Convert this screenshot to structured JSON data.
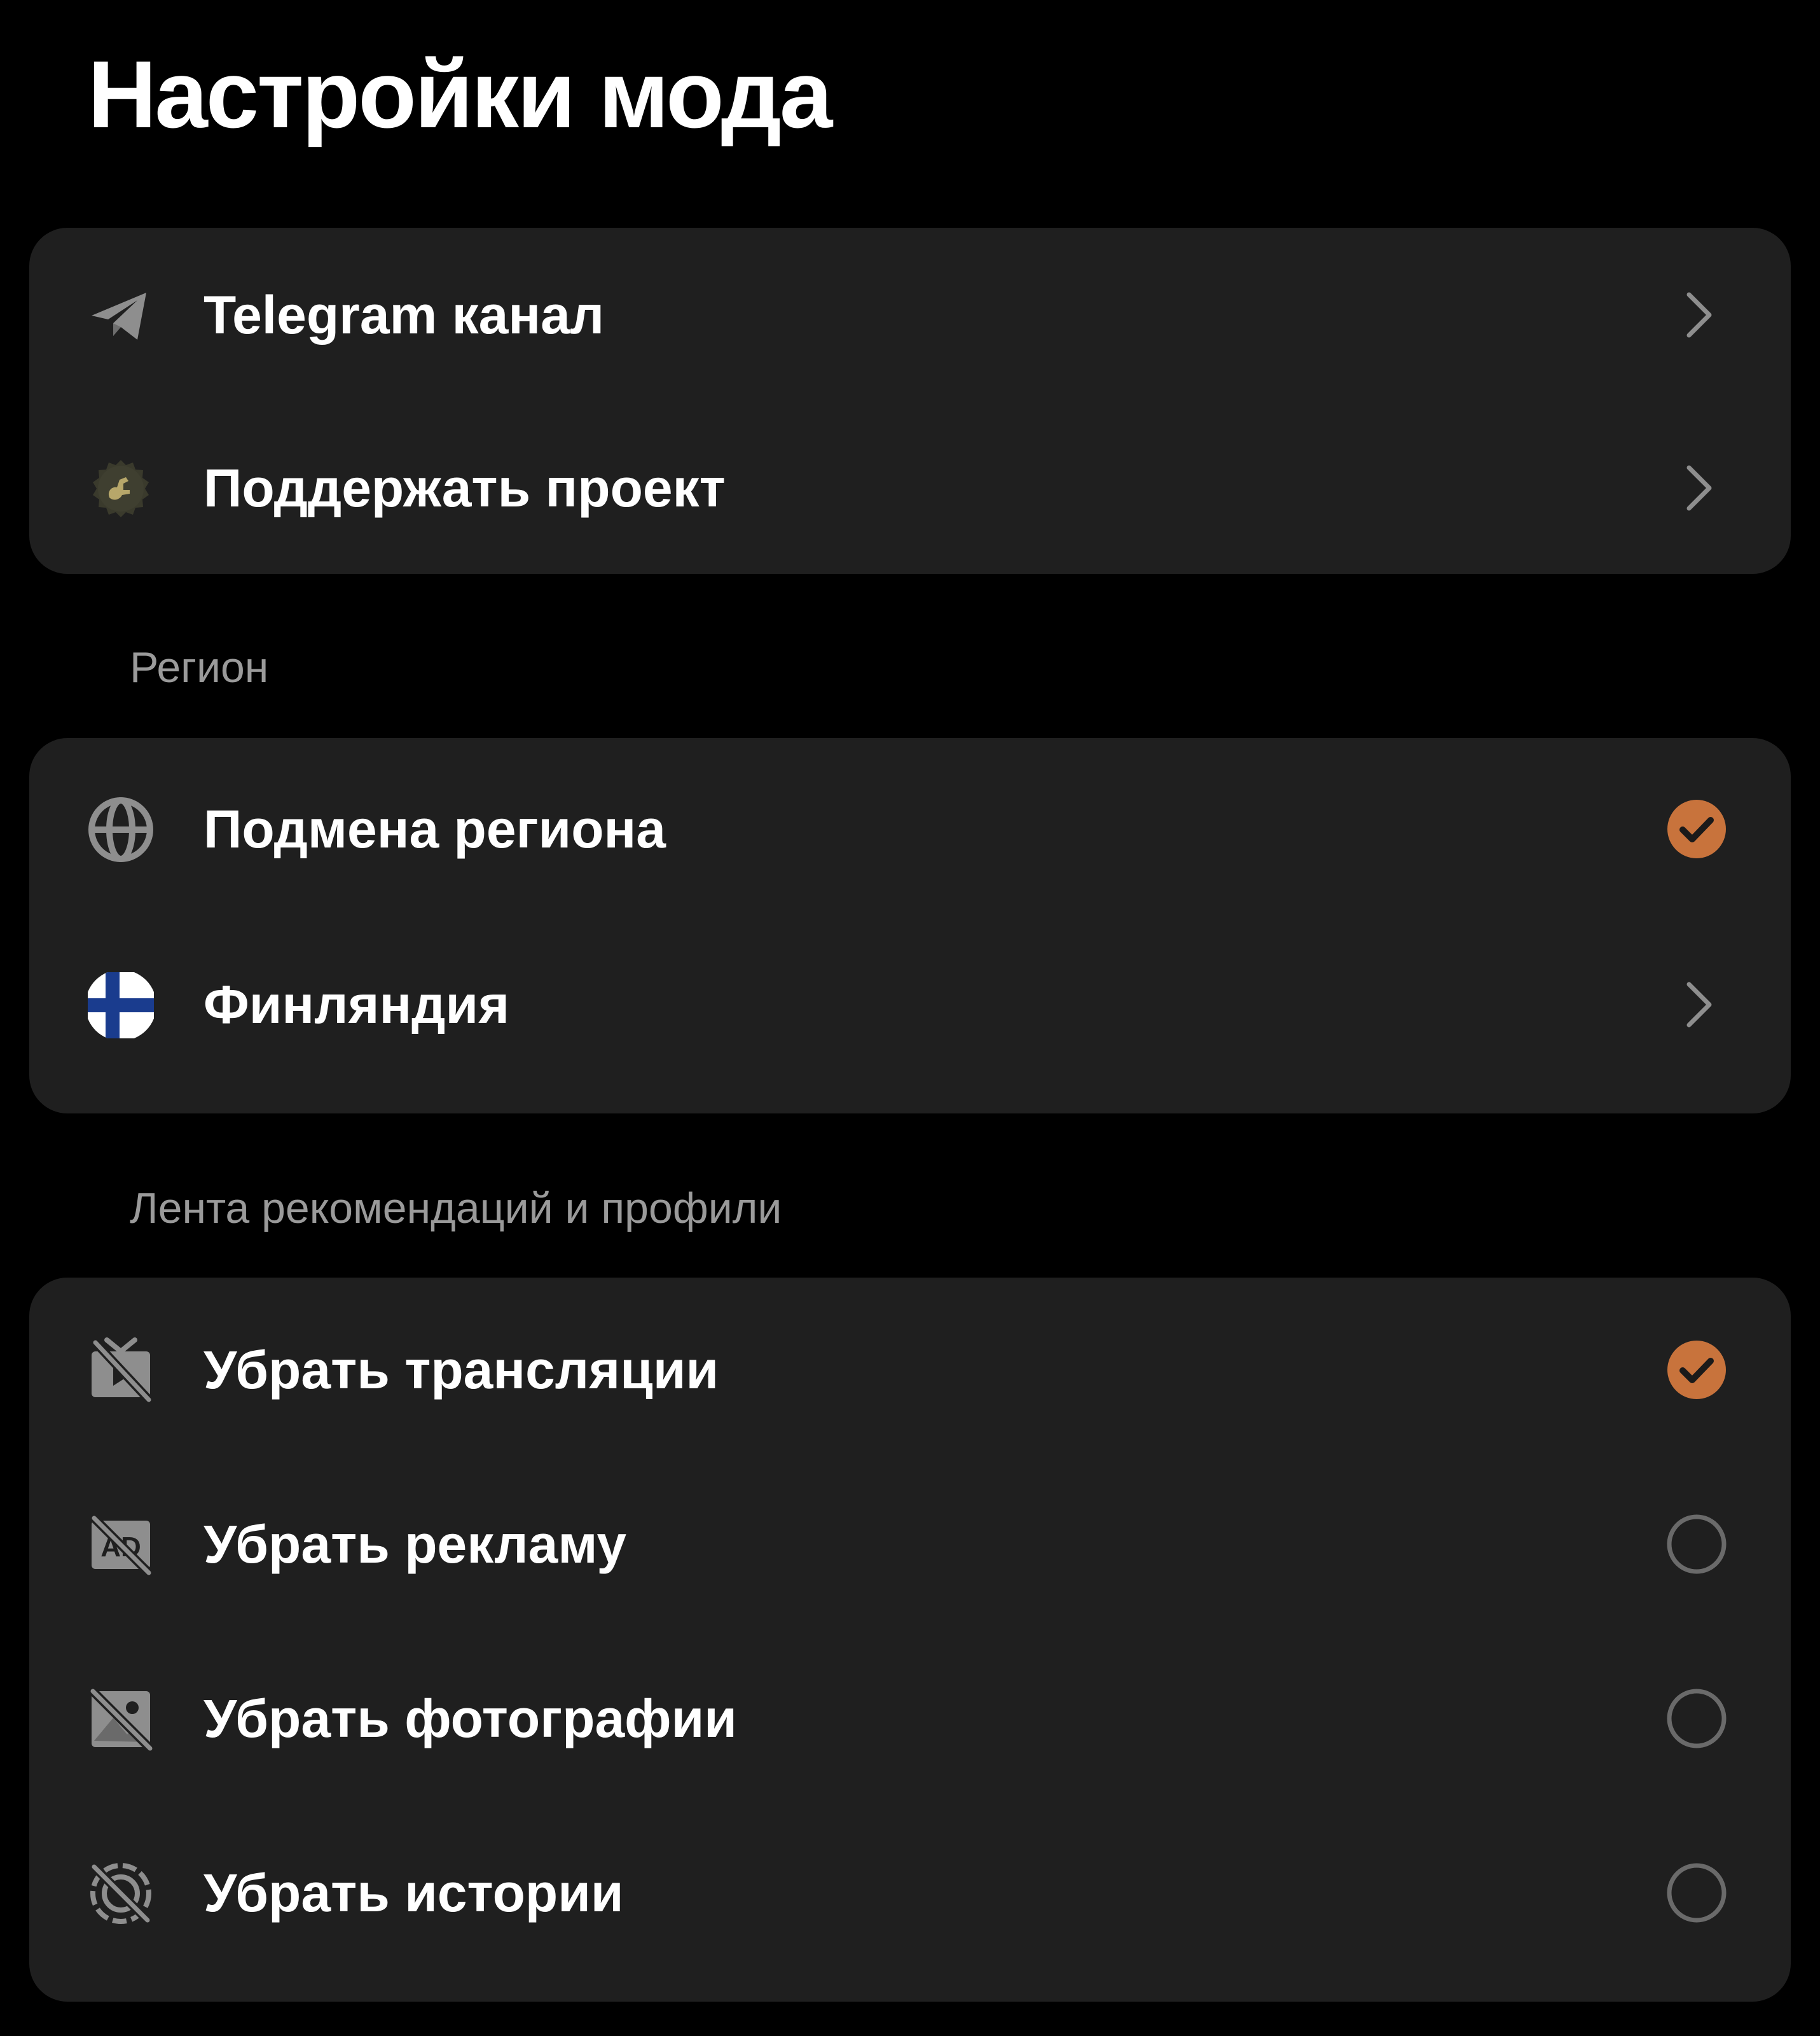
{
  "title": "Настройки мода",
  "links_card": {
    "items": [
      {
        "label": "Telegram канал",
        "icon": "telegram-icon",
        "trailing": "chevron-right-icon"
      },
      {
        "label": "Поддержать проект",
        "icon": "support-project-icon",
        "trailing": "chevron-right-icon"
      }
    ]
  },
  "region_section": {
    "header": "Регион",
    "items": [
      {
        "label": "Подмена региона",
        "icon": "globe-icon",
        "trailing": "check-circle-icon",
        "checked": true
      },
      {
        "label": "Финляндия",
        "icon": "finland-flag-icon",
        "trailing": "chevron-right-icon"
      }
    ]
  },
  "feed_section": {
    "header": "Лента рекомендаций и профили",
    "items": [
      {
        "label": "Убрать трансляции",
        "icon": "no-live-icon",
        "trailing": "check-circle-icon",
        "checked": true
      },
      {
        "label": "Убрать рекламу",
        "icon": "no-ads-icon",
        "trailing": "radio-empty-icon",
        "checked": false
      },
      {
        "label": "Убрать фотографии",
        "icon": "no-photos-icon",
        "trailing": "radio-empty-icon",
        "checked": false
      },
      {
        "label": "Убрать истории",
        "icon": "no-stories-icon",
        "trailing": "radio-empty-icon",
        "checked": false
      }
    ]
  },
  "colors": {
    "background": "#000000",
    "card": "#1f1f1f",
    "accent": "#c8733c",
    "icon_gray": "#8e8e8e",
    "header_gray": "#9a9a9a"
  }
}
